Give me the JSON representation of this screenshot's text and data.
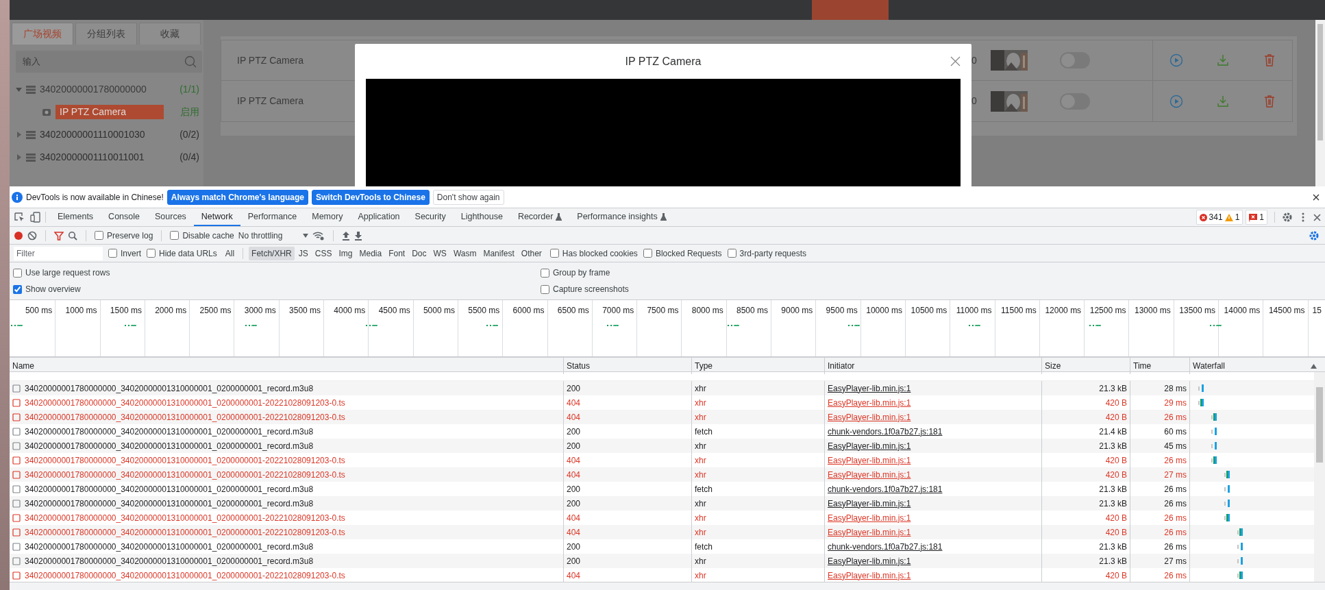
{
  "app": {
    "top_bar": {
      "highlighted_tab": true
    },
    "sidebar": {
      "tabs": [
        {
          "label": "广场视频",
          "selected": true
        },
        {
          "label": "分组列表",
          "selected": false
        },
        {
          "label": "收藏",
          "selected": false
        }
      ],
      "search": {
        "placeholder": "输入"
      },
      "tree": [
        {
          "label": "34020000001780000000",
          "count": "(1/1)",
          "expanded": true,
          "online": true,
          "children": [
            {
              "label": "IP PTZ Camera",
              "status": "启用",
              "selected": true
            }
          ]
        },
        {
          "label": "34020000001110001030",
          "count": "(0/2)",
          "expanded": false,
          "online": false
        },
        {
          "label": "34020000001110011001",
          "count": "(0/4)",
          "expanded": false,
          "online": false
        }
      ]
    },
    "table": {
      "rows": [
        {
          "name": "IP PTZ Camera",
          "column_3": "0",
          "on": false
        },
        {
          "name": "IP PTZ Camera",
          "column_3": "0",
          "on": false
        }
      ]
    },
    "modal": {
      "title": "IP PTZ Camera"
    }
  },
  "devtools": {
    "infobar": {
      "message": "DevTools is now available in Chinese!",
      "buttons": [
        {
          "label": "Always match Chrome's language",
          "kind": "primary"
        },
        {
          "label": "Switch DevTools to Chinese",
          "kind": "primary"
        },
        {
          "label": "Don't show again",
          "kind": "secondary"
        }
      ]
    },
    "tabs": [
      {
        "label": "Elements",
        "selected": false
      },
      {
        "label": "Console",
        "selected": false
      },
      {
        "label": "Sources",
        "selected": false
      },
      {
        "label": "Network",
        "selected": true
      },
      {
        "label": "Performance",
        "selected": false
      },
      {
        "label": "Memory",
        "selected": false
      },
      {
        "label": "Application",
        "selected": false
      },
      {
        "label": "Security",
        "selected": false
      },
      {
        "label": "Lighthouse",
        "selected": false
      },
      {
        "label": "Recorder",
        "selected": false,
        "experimental": true
      },
      {
        "label": "Performance insights",
        "selected": false,
        "experimental": true
      }
    ],
    "counters": {
      "errors": "341",
      "warnings": "1",
      "issues": "1"
    },
    "toolbar": {
      "recording": true,
      "preserve_log": {
        "label": "Preserve log",
        "checked": false
      },
      "disable_cache": {
        "label": "Disable cache",
        "checked": false
      },
      "throttling": "No throttling"
    },
    "filter": {
      "placeholder": "Filter",
      "invert": {
        "label": "Invert",
        "checked": false
      },
      "hide_data_urls": {
        "label": "Hide data URLs",
        "checked": false
      },
      "types": [
        {
          "label": "All",
          "selected": false
        },
        {
          "label": "Fetch/XHR",
          "selected": true
        },
        {
          "label": "JS",
          "selected": false
        },
        {
          "label": "CSS",
          "selected": false
        },
        {
          "label": "Img",
          "selected": false
        },
        {
          "label": "Media",
          "selected": false
        },
        {
          "label": "Font",
          "selected": false
        },
        {
          "label": "Doc",
          "selected": false
        },
        {
          "label": "WS",
          "selected": false
        },
        {
          "label": "Wasm",
          "selected": false
        },
        {
          "label": "Manifest",
          "selected": false
        },
        {
          "label": "Other",
          "selected": false
        }
      ],
      "checks": [
        {
          "label": "Has blocked cookies",
          "checked": false
        },
        {
          "label": "Blocked Requests",
          "checked": false
        },
        {
          "label": "3rd-party requests",
          "checked": false
        }
      ]
    },
    "options": [
      {
        "label": "Use large request rows",
        "checked": false
      },
      {
        "label": "Group by frame",
        "checked": false
      },
      {
        "label": "Show overview",
        "checked": true
      },
      {
        "label": "Capture screenshots",
        "checked": false
      }
    ],
    "overview": {
      "ticks": [
        "500 ms",
        "1000 ms",
        "1500 ms",
        "2000 ms",
        "2500 ms",
        "3000 ms",
        "3500 ms",
        "4000 ms",
        "4500 ms",
        "5000 ms",
        "5500 ms",
        "6000 ms",
        "6500 ms",
        "7000 ms",
        "7500 ms",
        "8000 ms",
        "8500 ms",
        "9000 ms",
        "9500 ms",
        "10000 ms",
        "10500 ms",
        "11000 ms",
        "11500 ms",
        "12000 ms",
        "12500 ms",
        "13000 ms",
        "13500 ms",
        "14000 ms",
        "14500 ms",
        "15"
      ]
    },
    "table": {
      "columns": [
        "Name",
        "Status",
        "Type",
        "Initiator",
        "Size",
        "Time",
        "Waterfall"
      ],
      "rows": [
        {
          "name": "34020000001780000000_34020000001310000001_0200000001_record.m3u8",
          "status": "200",
          "type": "xhr",
          "initiator": "EasyPlayer-lib.min.js:1",
          "size": "21.3 kB",
          "time": "28 ms",
          "failed": false
        },
        {
          "name": "34020000001780000000_34020000001310000001_0200000001-20221028091203-0.ts",
          "status": "404",
          "type": "xhr",
          "initiator": "EasyPlayer-lib.min.js:1",
          "size": "420 B",
          "time": "29 ms",
          "failed": true
        },
        {
          "name": "34020000001780000000_34020000001310000001_0200000001-20221028091203-0.ts",
          "status": "404",
          "type": "xhr",
          "initiator": "EasyPlayer-lib.min.js:1",
          "size": "420 B",
          "time": "26 ms",
          "failed": true
        },
        {
          "name": "34020000001780000000_34020000001310000001_0200000001_record.m3u8",
          "status": "200",
          "type": "fetch",
          "initiator": "chunk-vendors.1f0a7b27.js:181",
          "size": "21.4 kB",
          "time": "60 ms",
          "failed": false
        },
        {
          "name": "34020000001780000000_34020000001310000001_0200000001_record.m3u8",
          "status": "200",
          "type": "xhr",
          "initiator": "EasyPlayer-lib.min.js:1",
          "size": "21.3 kB",
          "time": "45 ms",
          "failed": false
        },
        {
          "name": "34020000001780000000_34020000001310000001_0200000001-20221028091203-0.ts",
          "status": "404",
          "type": "xhr",
          "initiator": "EasyPlayer-lib.min.js:1",
          "size": "420 B",
          "time": "26 ms",
          "failed": true
        },
        {
          "name": "34020000001780000000_34020000001310000001_0200000001-20221028091203-0.ts",
          "status": "404",
          "type": "xhr",
          "initiator": "EasyPlayer-lib.min.js:1",
          "size": "420 B",
          "time": "27 ms",
          "failed": true
        },
        {
          "name": "34020000001780000000_34020000001310000001_0200000001_record.m3u8",
          "status": "200",
          "type": "fetch",
          "initiator": "chunk-vendors.1f0a7b27.js:181",
          "size": "21.3 kB",
          "time": "26 ms",
          "failed": false
        },
        {
          "name": "34020000001780000000_34020000001310000001_0200000001_record.m3u8",
          "status": "200",
          "type": "xhr",
          "initiator": "EasyPlayer-lib.min.js:1",
          "size": "21.3 kB",
          "time": "26 ms",
          "failed": false
        },
        {
          "name": "34020000001780000000_34020000001310000001_0200000001-20221028091203-0.ts",
          "status": "404",
          "type": "xhr",
          "initiator": "EasyPlayer-lib.min.js:1",
          "size": "420 B",
          "time": "26 ms",
          "failed": true
        },
        {
          "name": "34020000001780000000_34020000001310000001_0200000001-20221028091203-0.ts",
          "status": "404",
          "type": "xhr",
          "initiator": "EasyPlayer-lib.min.js:1",
          "size": "420 B",
          "time": "26 ms",
          "failed": true
        },
        {
          "name": "34020000001780000000_34020000001310000001_0200000001_record.m3u8",
          "status": "200",
          "type": "fetch",
          "initiator": "chunk-vendors.1f0a7b27.js:181",
          "size": "21.3 kB",
          "time": "26 ms",
          "failed": false
        },
        {
          "name": "34020000001780000000_34020000001310000001_0200000001_record.m3u8",
          "status": "200",
          "type": "xhr",
          "initiator": "EasyPlayer-lib.min.js:1",
          "size": "21.3 kB",
          "time": "27 ms",
          "failed": false
        },
        {
          "name": "34020000001780000000_34020000001310000001_0200000001-20221028091203-0.ts",
          "status": "404",
          "type": "xhr",
          "initiator": "EasyPlayer-lib.min.js:1",
          "size": "420 B",
          "time": "26 ms",
          "failed": true
        }
      ]
    }
  }
}
